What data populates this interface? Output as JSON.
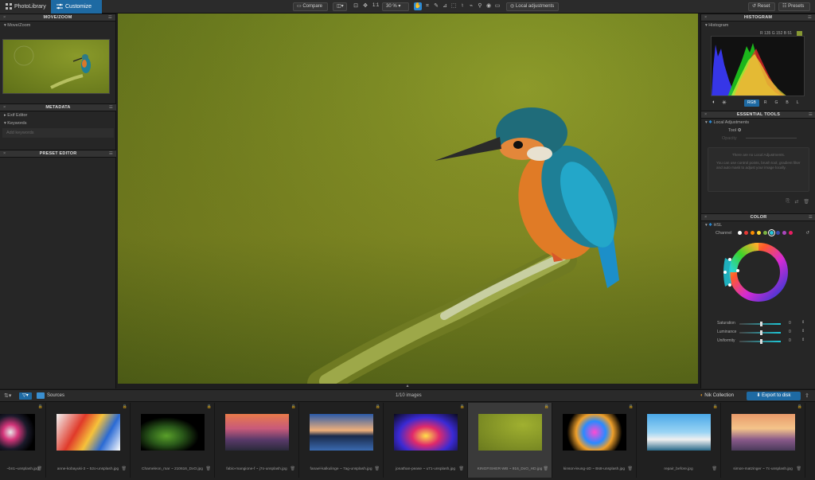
{
  "top": {
    "tab_library": "PhotoLibrary",
    "tab_customize": "Customize",
    "compare": "Compare",
    "zoom_1to1": "1:1",
    "zoom": "30 %",
    "local_adjustments": "Local adjustments",
    "reset": "Reset",
    "presets": "Presets"
  },
  "left": {
    "move_zoom_title": "MOVE/ZOOM",
    "move_zoom_row": "Move/Zoom",
    "metadata_title": "METADATA",
    "exif_editor": "Exif Editor",
    "keywords": "Keywords",
    "add_keywords_placeholder": "Add keywords",
    "preset_editor_title": "PRESET EDITOR"
  },
  "right": {
    "histogram_title": "HISTOGRAM",
    "histogram_row": "Histogram",
    "rgb_readout": "R 135 G 152 B 51",
    "channels": [
      "RGB",
      "R",
      "G",
      "B",
      "L"
    ],
    "essential_title": "ESSENTIAL TOOLS",
    "local_adj_row": "Local Adjustments",
    "tool_label": "Tool",
    "opacity_label": "Opacity",
    "empty_msg_1": "There are no Local Adjustments.",
    "empty_msg_2": "You can use control points, brush tool, gradient filter and auto mask to adjust your image locally.",
    "color_title": "COLOR",
    "hsl_row": "HSL",
    "channel_label": "Channel",
    "channel_colors": [
      "#ffffff",
      "#e53935",
      "#fb8c00",
      "#fdd835",
      "#7cb342",
      "#26c6da",
      "#3949ab",
      "#ab47bc",
      "#e91e63"
    ],
    "sliders": [
      {
        "label": "Saturation",
        "value": "0",
        "level": 0.5
      },
      {
        "label": "Luminance",
        "value": "0",
        "level": 0.5
      },
      {
        "label": "Uniformity",
        "value": "0",
        "level": 0.5
      }
    ]
  },
  "filmstrip": {
    "sources": "Sources",
    "count": "1/10 images",
    "nik": "Nik Collection",
    "export": "Export to disk",
    "items": [
      {
        "name": "~bn1~unsplash.jpg"
      },
      {
        "name": "anne-kobayuki-3 ~ 52o-unsplash.jpg"
      },
      {
        "name": "Chameleon_mar ~ 210616_DxO.jpg"
      },
      {
        "name": "fabio-mangione-f ~ j7o-unsplash.jpg"
      },
      {
        "name": "fanael-kalkulinge ~ 7ag-unsplash.jpg"
      },
      {
        "name": "jonathan-pease ~ u71-unsplash.jpg"
      },
      {
        "name": "KINGFISHER-WB ~ 916_DxO_HD.jpg"
      },
      {
        "name": "kinson-leung-oD ~ Bs8-unsplash.jpg"
      },
      {
        "name": "repair_before.jpg"
      },
      {
        "name": "simon-matzinger ~ 7c-unsplash.jpg"
      }
    ]
  }
}
